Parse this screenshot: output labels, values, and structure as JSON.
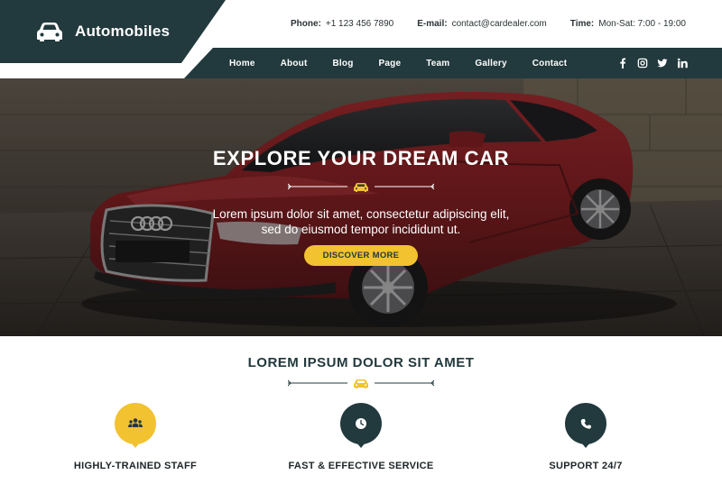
{
  "brand": {
    "name": "Automobiles",
    "logo_icon": "car-icon"
  },
  "contact": {
    "phone_label": "Phone:",
    "phone_value": "+1 123 456 7890",
    "email_label": "E-mail:",
    "email_value": "contact@cardealer.com",
    "time_label": "Time:",
    "time_value": "Mon-Sat: 7:00 - 19:00"
  },
  "nav": {
    "items": [
      {
        "label": "Home"
      },
      {
        "label": "About"
      },
      {
        "label": "Blog"
      },
      {
        "label": "Page"
      },
      {
        "label": "Team"
      },
      {
        "label": "Gallery"
      },
      {
        "label": "Contact"
      }
    ],
    "social": [
      "facebook-icon",
      "instagram-icon",
      "twitter-icon",
      "linkedin-icon"
    ]
  },
  "hero": {
    "title": "EXPLORE YOUR DREAM CAR",
    "text_line1": "Lorem ipsum dolor sit amet, consectetur adipiscing elit,",
    "text_line2": "sed do eiusmod tempor incididunt ut.",
    "button_label": "DISCOVER MORE"
  },
  "section": {
    "title": "LOREM IPSUM DOLOR SIT AMET",
    "features": [
      {
        "title": "HIGHLY-TRAINED STAFF",
        "icon": "team-icon",
        "color": "#f2c230"
      },
      {
        "title": "FAST & EFFECTIVE SERVICE",
        "icon": "clock-icon",
        "color": "#22393d"
      },
      {
        "title": "SUPPORT 24/7",
        "icon": "phone-icon",
        "color": "#22393d"
      }
    ]
  },
  "colors": {
    "dark": "#22393d",
    "accent": "#f2c230",
    "car": "#9c1f22"
  }
}
